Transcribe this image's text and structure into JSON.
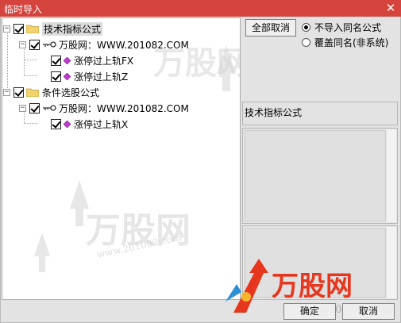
{
  "window": {
    "title": "临时导入",
    "close_glyph": "✕"
  },
  "tree": {
    "groups": [
      {
        "label": "技术指标公式",
        "expander": "−",
        "checked": true,
        "source": {
          "label": "万股网：WWW.201082.COM",
          "expander": "−",
          "checked": true
        },
        "items": [
          {
            "label": "涨停过上轨FX",
            "checked": true
          },
          {
            "label": "涨停过上轨Z",
            "checked": true
          }
        ]
      },
      {
        "label": "条件选股公式",
        "expander": "−",
        "checked": true,
        "source": {
          "label": "万股网：WWW.201082.COM",
          "expander": "−",
          "checked": true
        },
        "items": [
          {
            "label": "涨停过上轨X",
            "checked": true
          }
        ]
      }
    ]
  },
  "controls": {
    "cancel_all_label": "全部取消",
    "radio_options": [
      {
        "label": "不导入同名公式",
        "selected": true
      },
      {
        "label": "覆盖同名(非系统)",
        "selected": false
      }
    ],
    "info_label": "技术指标公式"
  },
  "footer": {
    "ok_label": "确定",
    "cancel_label": "取消"
  },
  "watermark": {
    "brand_text": "万股网",
    "url_text": "www.201082.com"
  },
  "colors": {
    "titlebar": "#d5443c",
    "folder": "#f2d36b",
    "gem": "#c03bd1",
    "watermark_red": "#e6371e",
    "watermark_blue": "#2b8fd6",
    "watermark_gray": "#c8c8c8"
  },
  "icons": {
    "folder": "folder-icon",
    "key": "key-icon",
    "gem": "diamond-icon",
    "close": "close-icon"
  }
}
